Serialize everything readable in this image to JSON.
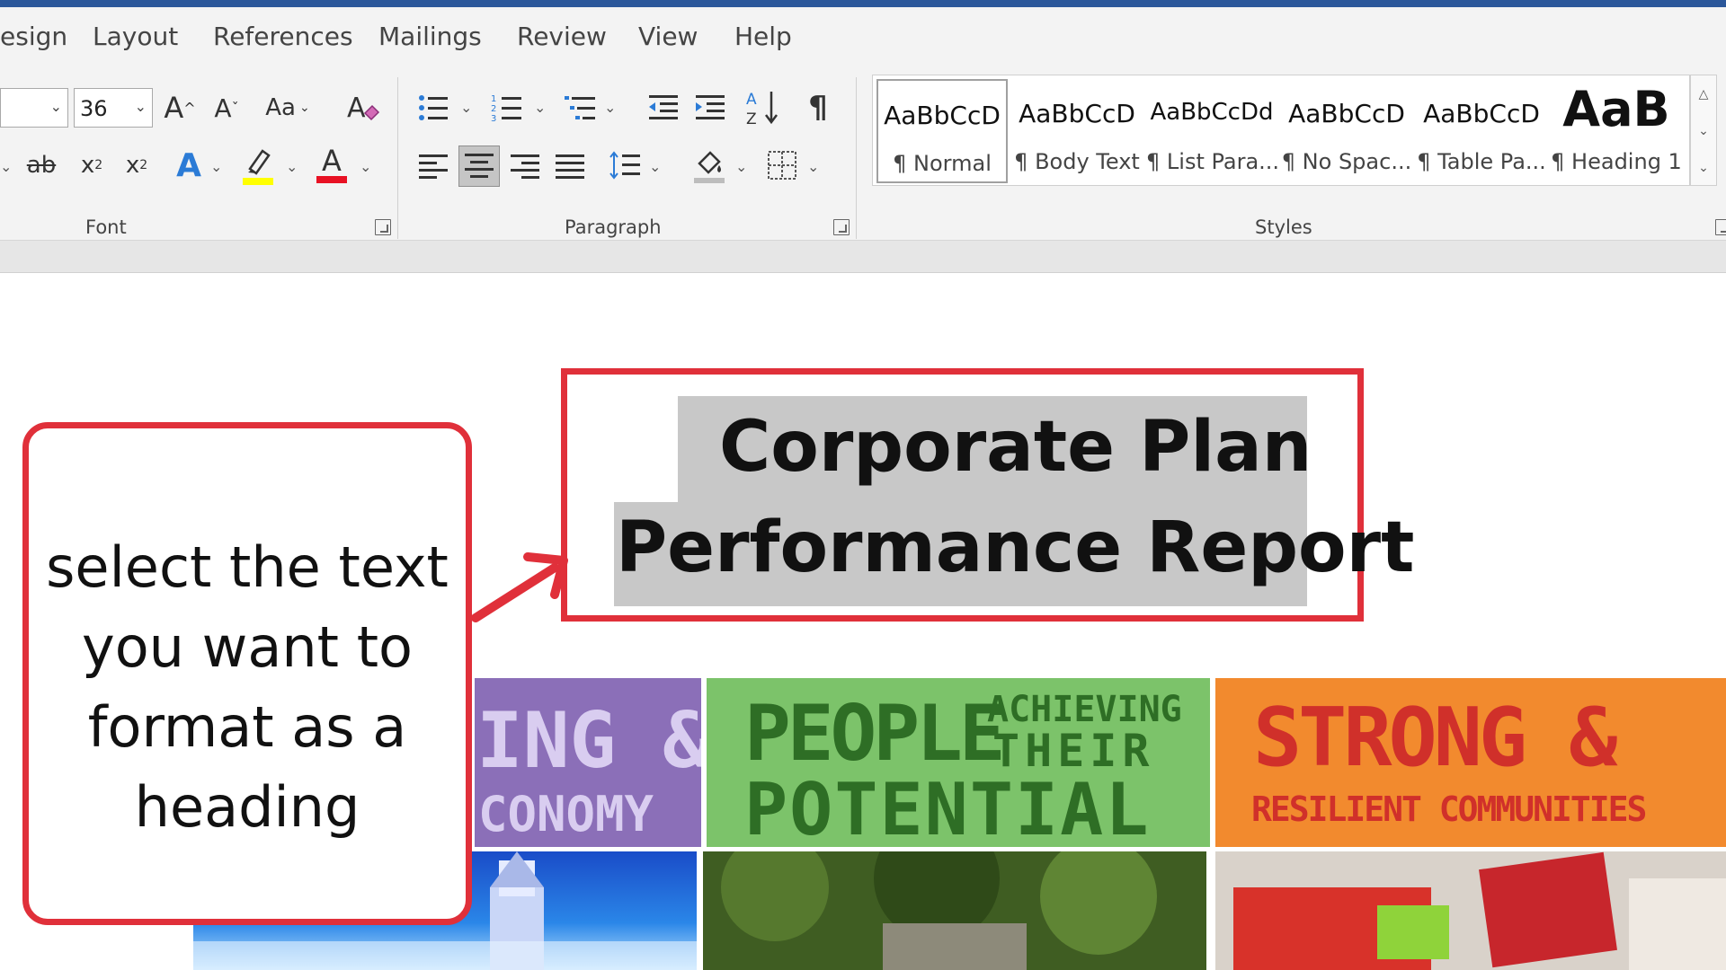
{
  "ribbon_tabs": [
    "esign",
    "Layout",
    "References",
    "Mailings",
    "Review",
    "View",
    "Help"
  ],
  "font_group": {
    "label": "Font",
    "font_size": "36",
    "grow_label": "A",
    "shrink_label": "A",
    "change_case_label": "Aa",
    "strikethrough_label": "ab",
    "subscript_label": "x",
    "superscript_label": "x",
    "text_effects_label": "A",
    "font_color_label": "A",
    "highlight_color": "#ffff00",
    "font_color": "#e81123"
  },
  "paragraph_group": {
    "label": "Paragraph"
  },
  "styles_group": {
    "label": "Styles",
    "items": [
      {
        "sample": "AaBbCcD",
        "name": "¶ Normal"
      },
      {
        "sample": "AaBbCcD",
        "name": "¶ Body Text"
      },
      {
        "sample": "AaBbCcDd",
        "name": "¶ List Para..."
      },
      {
        "sample": "AaBbCcD",
        "name": "¶ No Spac..."
      },
      {
        "sample": "AaBbCcD",
        "name": "¶ Table Pa..."
      },
      {
        "sample": "AaB",
        "name": "¶ Heading 1"
      }
    ]
  },
  "document": {
    "title_line1": "Corporate Plan",
    "title_line2": "Performance Report",
    "banners": [
      {
        "text_main": "ING &",
        "text_sub": "CONOMY",
        "bg": "#8b6fb8"
      },
      {
        "text_main": "PEOPLE",
        "text_side1": "ACHIEVING",
        "text_side2": "THEIR",
        "text_sub": "POTENTIAL",
        "bg": "#7cc36a"
      },
      {
        "text_main": "STRONG &",
        "text_sub": "RESILIENT COMMUNITIES",
        "bg": "#f28a2e"
      }
    ]
  },
  "callout": {
    "lines": [
      "select the text",
      "you want to",
      "format as a",
      "heading"
    ]
  },
  "colors": {
    "accent_red": "#e0303a",
    "ribbon_bg": "#f3f3f3",
    "title_bar": "#2b579a"
  }
}
